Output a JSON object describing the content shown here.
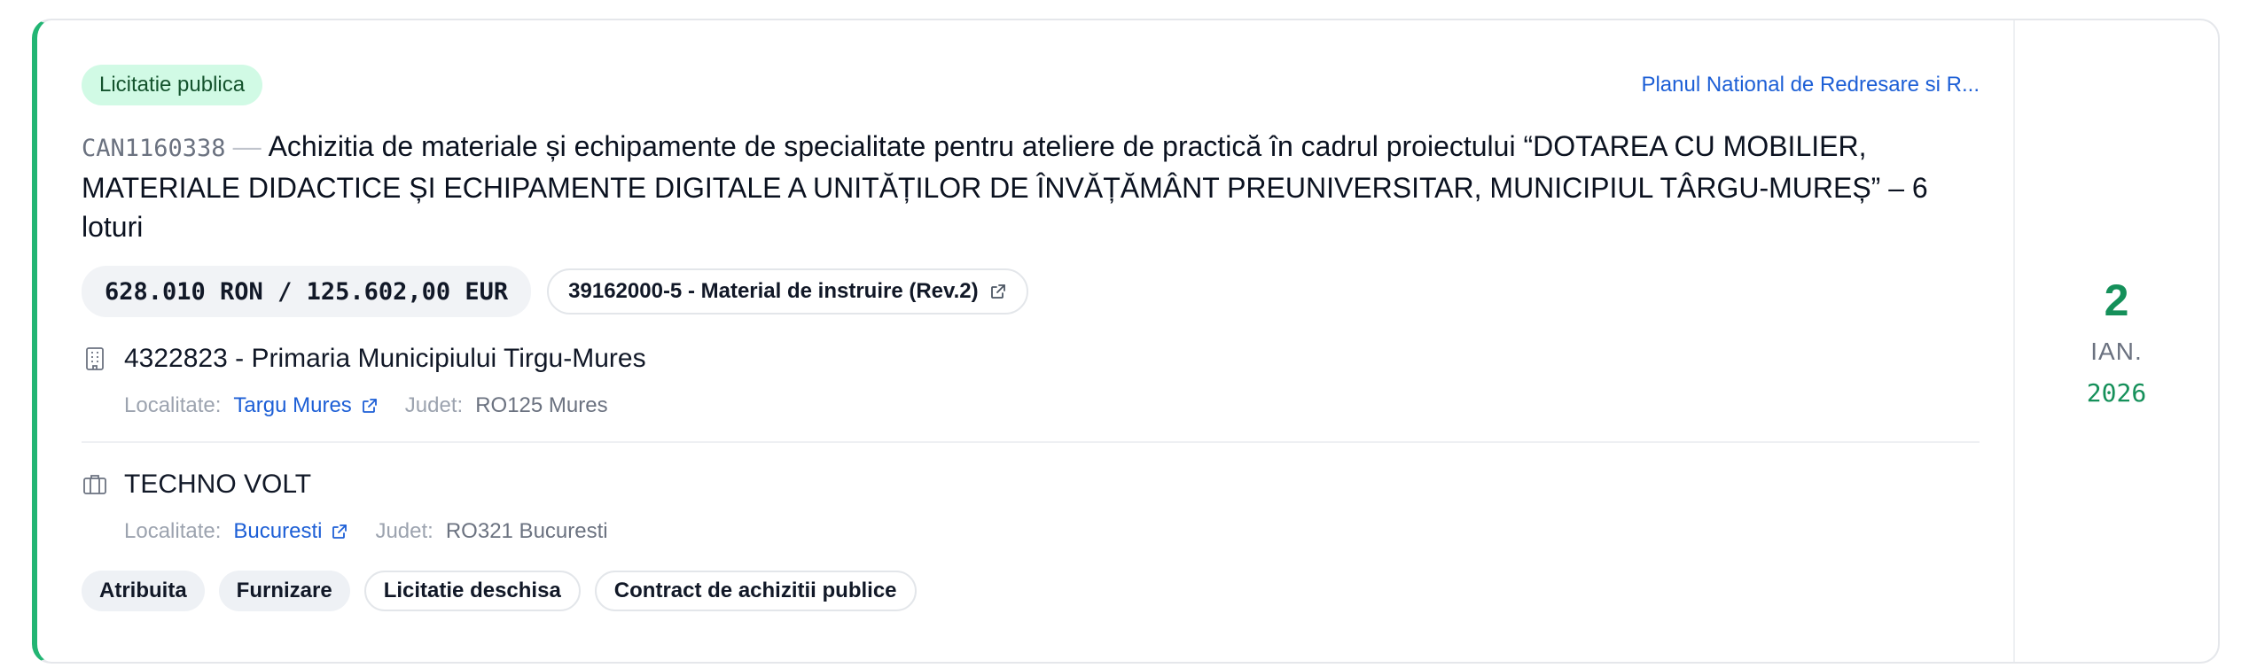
{
  "notice": {
    "type_badge": "Licitatie publica",
    "program_link": "Planul National de Redresare si R...",
    "code": "CAN1160338",
    "separator": "—",
    "title": "Achizitia de materiale și echipamente de specialitate pentru ateliere de practică în cadrul proiectului “DOTAREA CU MOBILIER, MATERIALE DIDACTICE ȘI ECHIPAMENTE DIGITALE A UNITĂȚILOR DE ÎNVĂȚĂMÂNT PREUNIVERSITAR, MUNICIPIUL TÂRGU-MUREȘ” – 6 loturi",
    "amount": "628.010 RON / 125.602,00 EUR",
    "cpv": "39162000-5 - Material de instruire (Rev.2)"
  },
  "authority": {
    "name": "4322823 - Primaria Municipiului Tirgu-Mures",
    "locality_label": "Localitate:",
    "locality": "Targu Mures",
    "county_label": "Judet:",
    "county": "RO125 Mures",
    "icon": "building-icon"
  },
  "supplier": {
    "name": "TECHNO VOLT",
    "locality_label": "Localitate:",
    "locality": "Bucuresti",
    "county_label": "Judet:",
    "county": "RO321 Bucuresti",
    "icon": "briefcase-icon"
  },
  "tags": [
    {
      "label": "Atribuita"
    },
    {
      "label": "Furnizare"
    },
    {
      "label": "Licitatie deschisa"
    },
    {
      "label": "Contract de achizitii publice"
    }
  ],
  "date": {
    "day": "2",
    "month": "IAN.",
    "year": "2026"
  },
  "colors": {
    "accent": "#22b573",
    "badge_bg": "#d1fae5",
    "link": "#1d5fd6",
    "date_green": "#15905a"
  }
}
